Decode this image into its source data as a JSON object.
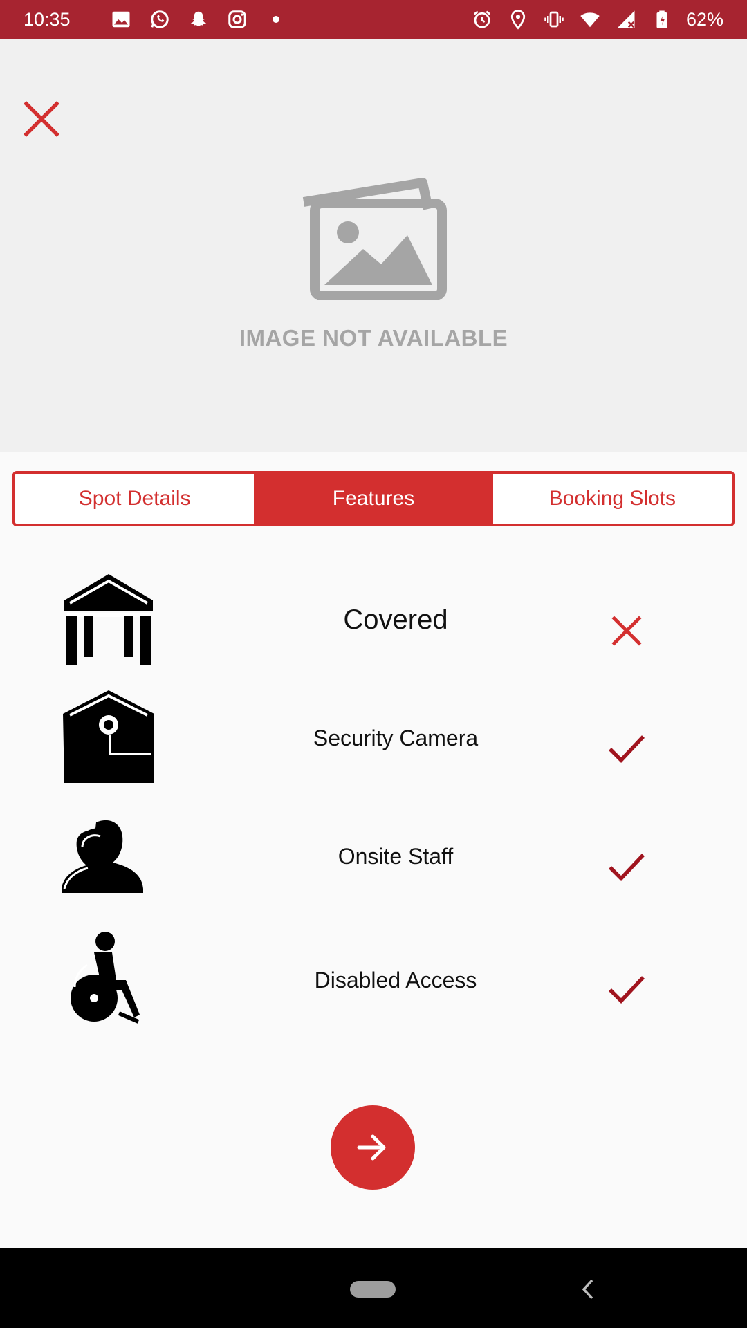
{
  "status_bar": {
    "time": "10:35",
    "battery_percent": "62%",
    "left_icons": [
      "gallery-icon",
      "whatsapp-icon",
      "snapchat-icon",
      "instagram-icon",
      "dot-icon"
    ],
    "right_icons": [
      "alarm-icon",
      "location-icon",
      "vibrate-icon",
      "wifi-icon",
      "signal-icon",
      "battery-icon"
    ]
  },
  "hero": {
    "placeholder_text": "IMAGE NOT AVAILABLE"
  },
  "tabs": [
    {
      "label": "Spot Details",
      "active": false
    },
    {
      "label": "Features",
      "active": true
    },
    {
      "label": "Booking Slots",
      "active": false
    }
  ],
  "features": [
    {
      "label": "Covered",
      "icon": "covered-icon",
      "available": false
    },
    {
      "label": "Security Camera",
      "icon": "security-camera-icon",
      "available": true
    },
    {
      "label": "Onsite Staff",
      "icon": "onsite-staff-icon",
      "available": true
    },
    {
      "label": "Disabled Access",
      "icon": "disabled-access-icon",
      "available": true
    }
  ],
  "colors": {
    "status_bar": "#a72430",
    "accent": "#d32f2f",
    "check": "#a0141e",
    "hero_background": "#f0f0f0",
    "placeholder": "#a5a5a5"
  }
}
